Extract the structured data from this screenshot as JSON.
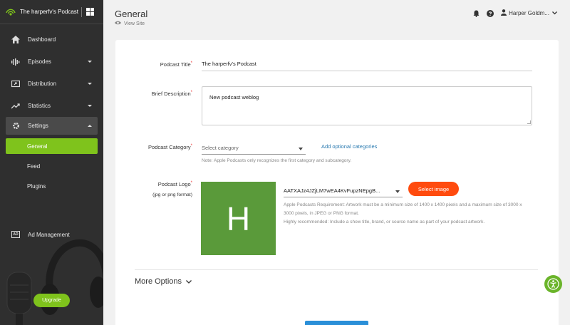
{
  "sidebar": {
    "brand_name": "The harperfv's Podcast",
    "items": [
      {
        "label": "Dashboard",
        "icon": "home-icon"
      },
      {
        "label": "Episodes",
        "icon": "waveform-icon"
      },
      {
        "label": "Distribution",
        "icon": "share-screen-icon"
      },
      {
        "label": "Statistics",
        "icon": "trending-icon"
      },
      {
        "label": "Settings",
        "icon": "gear-icon"
      }
    ],
    "settings_sub": [
      "General",
      "Feed",
      "Plugins"
    ],
    "ad_badge": "AD",
    "ad_label": "Ad Management",
    "upgrade_label": "Upgrade",
    "accent_color": "#7fc31c"
  },
  "header": {
    "title": "General",
    "view_site": "View Site",
    "user_name": "Harper Goldm..."
  },
  "form": {
    "title_label": "Podcast Title",
    "title_value": "The harperfv's Podcast",
    "desc_label": "Brief Description",
    "desc_value": "New podcast weblog",
    "category_label": "Podcast Category",
    "category_placeholder": "Select category",
    "add_categories": "Add optional categories",
    "category_note": "Note: Apple Podcasts only recognizes the first category and subcategory.",
    "logo_label": "Podcast Logo",
    "logo_format": "(jpg or png format)",
    "logo_letter": "H",
    "logo_color": "#5a9a3a",
    "file_name": "AATXAJz4JZjLM7wEA4KvFupzNEpgB...",
    "select_image": "Select image",
    "select_image_color": "#ff4b0e",
    "requirement_1": "Apple Podcasts Requirement: Artwork must be a minimum size of 1400 x 1400 pixels and a maximum size of 3000 x 3000 pixels, in JPEG or PNG format.",
    "requirement_2": "Highly recommended: Include a show title, brand, or source name as part of your podcast artwork.",
    "more_options": "More Options"
  }
}
